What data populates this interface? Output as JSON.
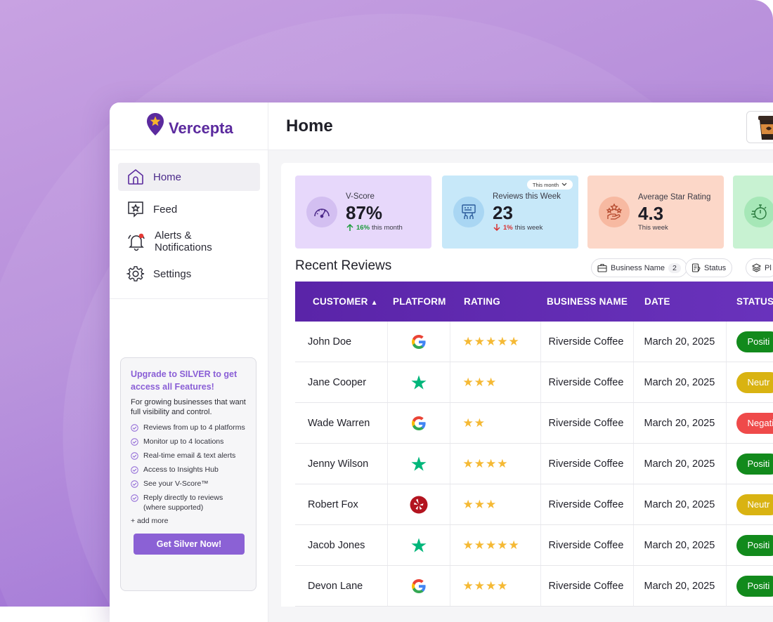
{
  "brand": {
    "name": "Vercepta",
    "accent": "#5b2a9e"
  },
  "sidebar": {
    "items": [
      {
        "label": "Home",
        "icon": "home-icon",
        "active": true
      },
      {
        "label": "Feed",
        "icon": "feed-icon"
      },
      {
        "label": "Alerts & Notifications",
        "icon": "bell-icon"
      },
      {
        "label": "Settings",
        "icon": "gear-icon"
      }
    ],
    "upgrade": {
      "title": "Upgrade to SILVER to get access all Features!",
      "description": "For growing businesses that want full visibility and control.",
      "features": [
        "Reviews from up to 4 platforms",
        "Monitor up to 4 locations",
        "Real-time email & text alerts",
        "Access to Insights Hub",
        "See your V-Score™",
        "Reply directly to reviews (where supported)"
      ],
      "more": "+ add more",
      "button": "Get Silver Now!"
    }
  },
  "header": {
    "title": "Home"
  },
  "stats": [
    {
      "label": "V-Score",
      "value": "87%",
      "change": "16%",
      "period": "this month",
      "direction": "up",
      "bg": "#e7d8fb",
      "icon": "gauge-icon"
    },
    {
      "label": "Reviews this Week",
      "value": "23",
      "change": "1%",
      "period": "this week",
      "direction": "down",
      "bg": "#c7e8f9",
      "icon": "review-board-icon",
      "dropdown": "This month"
    },
    {
      "label": "Average Star Rating",
      "value": "4.3",
      "period": "This week",
      "bg": "#fcd7c8",
      "icon": "stars-hand-icon"
    },
    {
      "bg": "#c8f2d2",
      "icon": "stopwatch-icon"
    }
  ],
  "reviews": {
    "title": "Recent Reviews",
    "filters": [
      {
        "label": "Business Name",
        "count": "2",
        "icon": "briefcase-icon"
      },
      {
        "label": "Status",
        "icon": "status-icon"
      },
      {
        "label": "Pl",
        "icon": "layers-icon"
      }
    ],
    "columns": [
      "CUSTOMER",
      "PLATFORM",
      "RATING",
      "BUSINESS NAME",
      "DATE",
      "STATUS"
    ],
    "rows": [
      {
        "customer": "John Doe",
        "platform": "google",
        "rating": 5,
        "rating_stars": "★★★★★",
        "business": "Riverside Coffee",
        "date": "March 20, 2025",
        "status": "Positi",
        "status_color": "#128a1c"
      },
      {
        "customer": "Jane Cooper",
        "platform": "trustpilot",
        "rating": 3,
        "rating_stars": "★★★",
        "business": "Riverside Coffee",
        "date": "March 20, 2025",
        "status": "Neutr",
        "status_color": "#d9b312"
      },
      {
        "customer": "Wade Warren",
        "platform": "google",
        "rating": 2,
        "rating_stars": "★★",
        "business": "Riverside Coffee",
        "date": "March 20, 2025",
        "status": "Negati",
        "status_color": "#ef4a4a"
      },
      {
        "customer": "Jenny Wilson",
        "platform": "trustpilot",
        "rating": 4,
        "rating_stars": "★★★★",
        "business": "Riverside Coffee",
        "date": "March 20, 2025",
        "status": "Positi",
        "status_color": "#128a1c"
      },
      {
        "customer": "Robert Fox",
        "platform": "yelp",
        "rating": 3,
        "rating_stars": "★★★",
        "business": "Riverside Coffee",
        "date": "March 20, 2025",
        "status": "Neutr",
        "status_color": "#d9b312"
      },
      {
        "customer": "Jacob Jones",
        "platform": "trustpilot",
        "rating": 5,
        "rating_stars": "★★★★★",
        "business": "Riverside Coffee",
        "date": "March 20, 2025",
        "status": "Positi",
        "status_color": "#128a1c"
      },
      {
        "customer": "Devon Lane",
        "platform": "google",
        "rating": 4,
        "rating_stars": "★★★★",
        "business": "Riverside Coffee",
        "date": "March 20, 2025",
        "status": "Positi",
        "status_color": "#128a1c"
      }
    ]
  }
}
